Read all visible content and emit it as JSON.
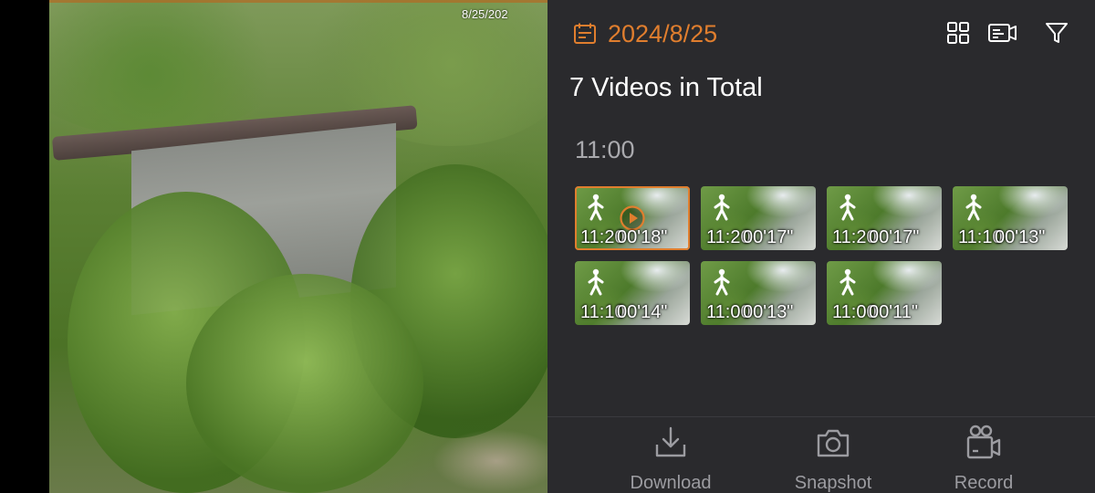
{
  "video": {
    "osd_timestamp": "8/25/202"
  },
  "panel": {
    "date": "2024/8/25",
    "total_label": "7 Videos in Total",
    "hour_group": "11:00",
    "clips": [
      {
        "time": "11:20",
        "duration": "00'18\"",
        "selected": true
      },
      {
        "time": "11:20",
        "duration": "00'17\"",
        "selected": false
      },
      {
        "time": "11:20",
        "duration": "00'17\"",
        "selected": false
      },
      {
        "time": "11:10",
        "duration": "00'13\"",
        "selected": false
      },
      {
        "time": "11:10",
        "duration": "00'14\"",
        "selected": false
      },
      {
        "time": "11:00",
        "duration": "00'13\"",
        "selected": false
      },
      {
        "time": "11:00",
        "duration": "00'11\"",
        "selected": false
      }
    ],
    "icons": {
      "calendar": "calendar-icon",
      "grid": "grid-view-icon",
      "device": "camera-device-icon",
      "filter": "filter-icon",
      "person": "person-motion-icon",
      "play": "play-icon"
    }
  },
  "footer": {
    "download_label": "Download",
    "snapshot_label": "Snapshot",
    "record_label": "Record"
  },
  "colors": {
    "accent": "#e07e2e",
    "panel_bg": "#2a2a2d",
    "muted_text": "#9c9ca1"
  }
}
